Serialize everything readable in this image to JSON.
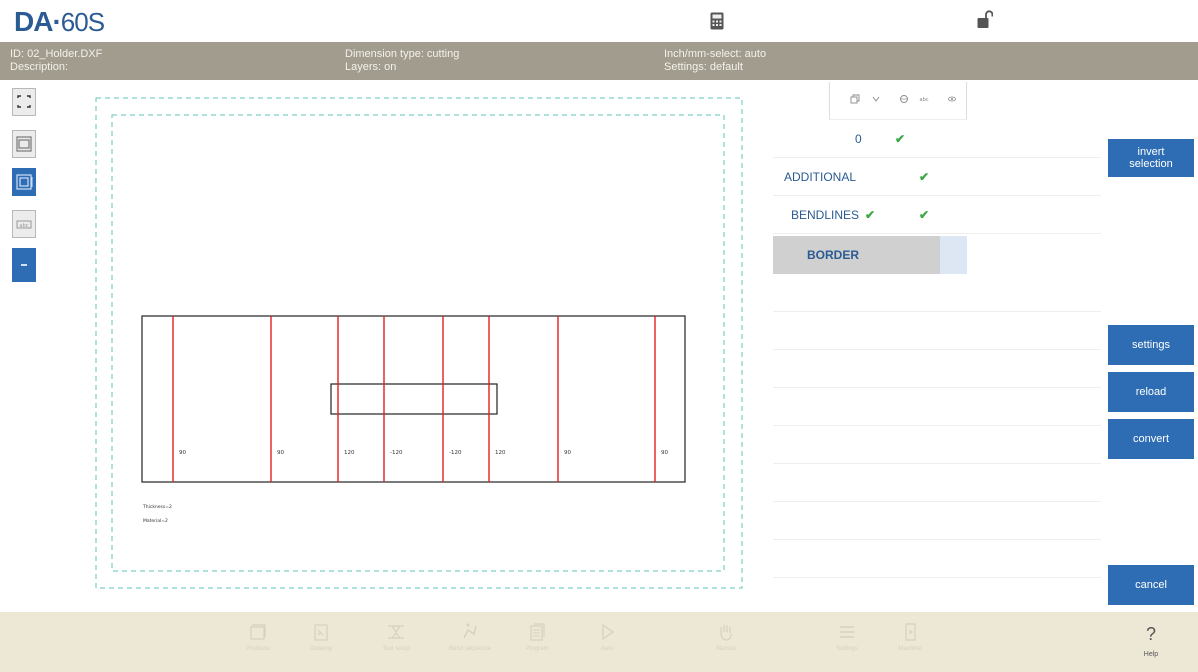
{
  "header": {
    "logo_brand": "DA",
    "logo_dot": "·",
    "logo_model": "60S",
    "calculator_icon": "calculator-icon",
    "lock_icon": "lock-open-icon"
  },
  "info": {
    "id": "ID: 02_Holder.DXF",
    "description": "Description:",
    "dimension_type": "Dimension type: cutting",
    "layers": "Layers: on",
    "unit_select": "Inch/mm-select: auto",
    "settings": "Settings: default"
  },
  "left_toolbar": [
    {
      "name": "zoom-extents-icon",
      "active": false
    },
    {
      "name": "view-frame-icon",
      "active": false
    },
    {
      "name": "layers-view-icon",
      "active": true
    },
    {
      "name": "dimension-icon",
      "active": false
    },
    {
      "name": "minus-icon",
      "active": true
    }
  ],
  "drawing": {
    "bend_labels": [
      "90",
      "90",
      "120",
      "-120",
      "-120",
      "120",
      "90",
      "90"
    ],
    "note_thickness": "Thickness=2",
    "note_material": "Material=2"
  },
  "layers_panel": {
    "header_icons": [
      "layer-icon",
      "chevron-down-icon",
      "circle-icon",
      "abc-icon",
      "eye-icon"
    ],
    "rows": [
      {
        "label": "0",
        "check1": "✔",
        "check2": ""
      },
      {
        "label": "ADDITIONAL",
        "check1": "",
        "check2": "✔"
      },
      {
        "label": "BENDLINES",
        "check1": "✔",
        "check2": "✔"
      },
      {
        "label": "BORDER",
        "check1": "",
        "check2": "",
        "selected": true
      }
    ]
  },
  "buttons": {
    "invert_line1": "invert",
    "invert_line2": "selection",
    "settings": "settings",
    "reload": "reload",
    "convert": "convert",
    "cancel": "cancel"
  },
  "bottom_nav": [
    {
      "name": "products",
      "label": "Products"
    },
    {
      "name": "drawing",
      "label": "Drawing"
    },
    {
      "name": "tool-setup",
      "label": "Tool setup"
    },
    {
      "name": "bend-sequence",
      "label": "Bend sequence"
    },
    {
      "name": "program",
      "label": "Program"
    },
    {
      "name": "auto",
      "label": "Auto"
    },
    {
      "name": "manual",
      "label": "Manual"
    },
    {
      "name": "settings",
      "label": "Settings"
    },
    {
      "name": "machine",
      "label": "Machine"
    }
  ],
  "help": {
    "symbol": "?",
    "label": "Help"
  },
  "colors": {
    "brand_blue": "#2a5b92",
    "button_blue": "#2e6db4",
    "info_bar": "#a19c8d",
    "bottom_bar": "#ede8d6",
    "bendline_red": "#e02020",
    "check_green": "#3aa843",
    "frame_teal": "#5fc4b4"
  }
}
